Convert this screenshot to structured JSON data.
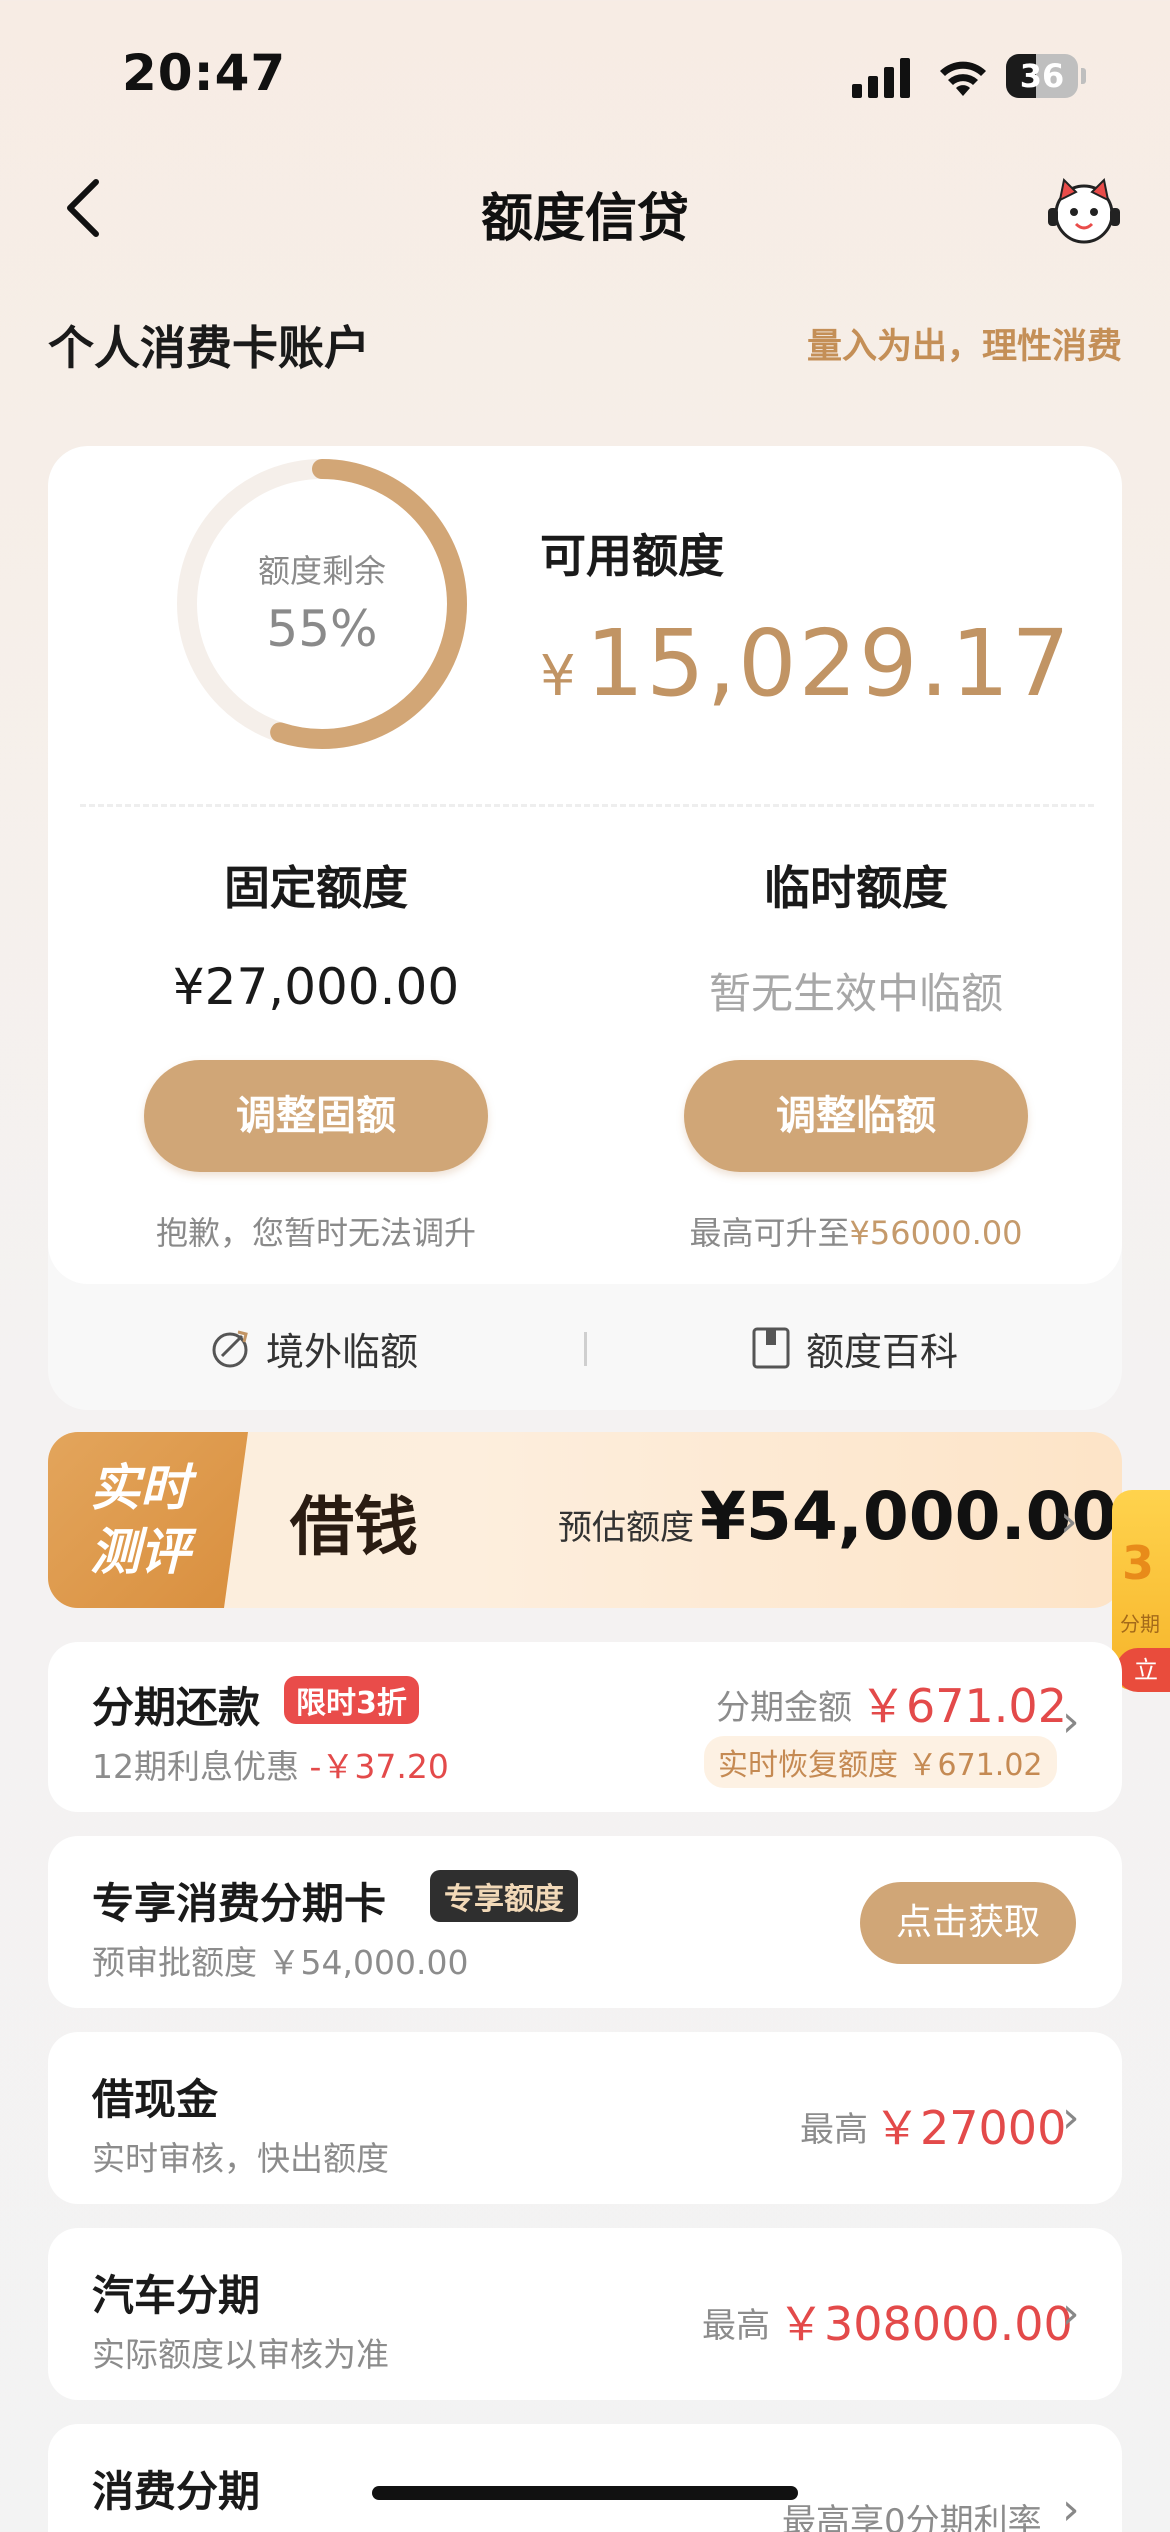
{
  "status": {
    "time": "20:47",
    "battery": "36"
  },
  "nav": {
    "title": "额度信贷"
  },
  "section": {
    "title": "个人消费卡账户",
    "slogan": "量入为出，理性消费"
  },
  "credit": {
    "ring_label": "额度剩余",
    "ring_value": "55%",
    "ring_fraction": 0.55,
    "available_label": "可用额度",
    "available_currency": "¥",
    "available_amount": "15,029.17",
    "fixed": {
      "title": "固定额度",
      "amount": "¥27,000.00",
      "button": "调整固额",
      "note": "抱歉，您暂时无法调升"
    },
    "temp": {
      "title": "临时额度",
      "status": "暂无生效中临额",
      "button": "调整临额",
      "note_prefix": "最高可升至",
      "note_amount": "¥56000.00"
    },
    "links": {
      "overseas": "境外临额",
      "wiki": "额度百科"
    }
  },
  "borrow": {
    "badge_line1": "实时",
    "badge_line2": "测评",
    "title": "借钱",
    "estimate_label": "预估额度",
    "estimate_amount": "¥54,000.00"
  },
  "side_float": {
    "digit": "3",
    "text": "分期",
    "button": "立"
  },
  "installment": {
    "title": "分期还款",
    "tag": "限时3折",
    "sub_prefix": "12期利息优惠",
    "sub_amount": "-￥37.20",
    "amount_label": "分期金额",
    "amount": "￥671.02",
    "recover": "实时恢复额度 ￥671.02"
  },
  "exclusive": {
    "title": "专享消费分期卡",
    "tag": "专享额度",
    "sub": "预审批额度 ￥54,000.00",
    "button": "点击获取"
  },
  "cash": {
    "title": "借现金",
    "sub": "实时审核，快出额度",
    "label": "最高",
    "amount": "￥27000"
  },
  "car": {
    "title": "汽车分期",
    "sub": "实际额度以审核为准",
    "label": "最高",
    "amount": "￥308000.00"
  },
  "consume": {
    "title": "消费分期",
    "right": "最高享0分期利率"
  },
  "colors": {
    "gold": "#c19464",
    "button": "#d0a677",
    "red": "#e34a4a",
    "tag_red": "#e94c4a"
  }
}
